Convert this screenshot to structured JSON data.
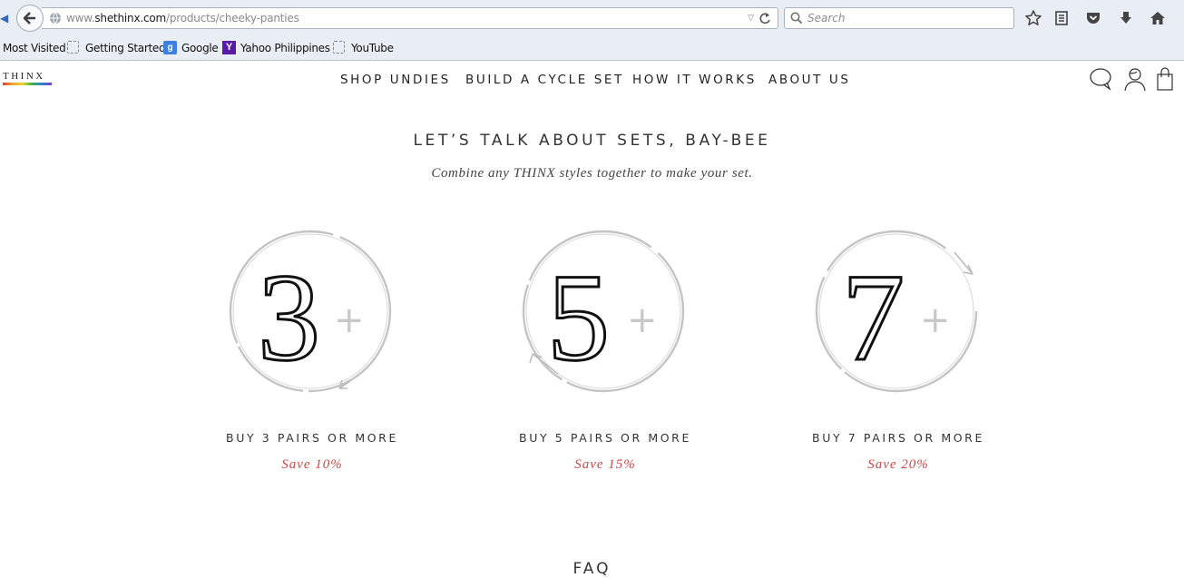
{
  "browser": {
    "url_prefix": "www.",
    "url_domain": "shethinx.com",
    "url_path": "/products/cheeky-panties",
    "search_placeholder": "Search"
  },
  "bookmarks": [
    {
      "label": "Most Visited",
      "icon": "none"
    },
    {
      "label": "Getting Started",
      "icon": "page-icon"
    },
    {
      "label": "Google",
      "icon": "google-icon"
    },
    {
      "label": "Yahoo Philippines",
      "icon": "yahoo-icon"
    },
    {
      "label": "YouTube",
      "icon": "page-icon"
    }
  ],
  "site": {
    "logo": "THINX",
    "nav": [
      "SHOP UNDIES",
      "BUILD A CYCLE SET",
      "HOW IT WORKS",
      "ABOUT US"
    ]
  },
  "main": {
    "headline": "LET’S TALK ABOUT SETS, BAY-BEE",
    "subhead": "Combine any THINX styles together to make your set.",
    "sets": [
      {
        "number": "3",
        "plus": "+",
        "label": "BUY 3 PAIRS OR MORE",
        "save": "Save 10%"
      },
      {
        "number": "5",
        "plus": "+",
        "label": "BUY 5 PAIRS OR MORE",
        "save": "Save 15%"
      },
      {
        "number": "7",
        "plus": "+",
        "label": "BUY 7 PAIRS OR MORE",
        "save": "Save 20%"
      }
    ],
    "faq": "FAQ"
  },
  "colors": {
    "accent_red": "#c94949",
    "chrome_bg": "#e9eef5"
  }
}
